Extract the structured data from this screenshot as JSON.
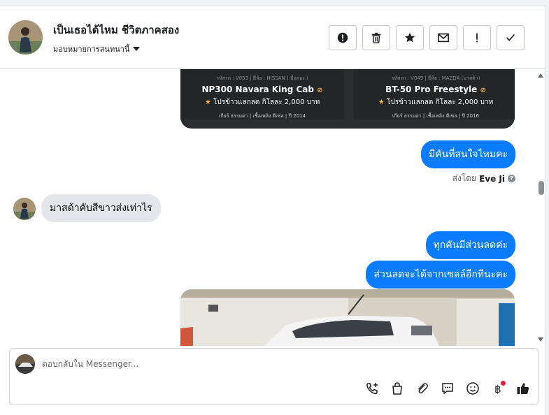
{
  "header": {
    "title": "เป็นเธอได้ไหม ชีวิตภาคสอง",
    "assign_label": "มอบหมายการสนทนานี้",
    "actions": [
      {
        "name": "alert-icon"
      },
      {
        "name": "trash-icon"
      },
      {
        "name": "star-icon"
      },
      {
        "name": "mail-icon"
      },
      {
        "name": "exclamation-icon"
      },
      {
        "name": "check-icon"
      }
    ]
  },
  "carousel": {
    "cards": [
      {
        "meta": "รหัสรถ : V053 | ยี่ห้อ : NISSAN ( มือสอง )",
        "name": "NP300 Navara King Cab",
        "promo": "โปรข้าวแลกลด กิโลละ 2,000 บาท",
        "specs": "เกียร์ ธรรมดา | เชื้อเพลิง ดีเซล | ปี 2014"
      },
      {
        "meta": "รหัสรถ : V049 | ยี่ห้อ : MAZDA (มาสด้า)",
        "name": "BT-50 Pro Freestyle",
        "promo": "โปรข้าวแลกลด กิโลละ 2,000 บาท",
        "specs": "เกียร์ ธรรมดา | เชื้อเพลิง ดีเซล | ปี 2016"
      }
    ]
  },
  "messages": {
    "m1": "มีคันที่สนใจไหมคะ",
    "sent_by_prefix": "ส่งโดย",
    "sent_by_name": "Eve Ji",
    "m2": "มาสด้าคับสีขาวส่งเท่าไร",
    "m3": "ทุกคันมีส่วนลดค่ะ",
    "m4": "ส่วนลดจะได้จากเซลล์อีกทีนะคะ"
  },
  "composer": {
    "placeholder": "ตอบกลับใน Messenger...",
    "value": "",
    "tools": [
      "phone-plus-icon",
      "shopping-bag-icon",
      "paperclip-icon",
      "chat-bubble-icon",
      "smiley-icon",
      "baht-icon",
      "thumbs-up-icon"
    ]
  },
  "colors": {
    "accent": "#0a7cff",
    "incoming": "#e4e6eb",
    "card_bg": "#242526",
    "badge_red": "#e41e3f",
    "promo_star": "#f7b928"
  }
}
